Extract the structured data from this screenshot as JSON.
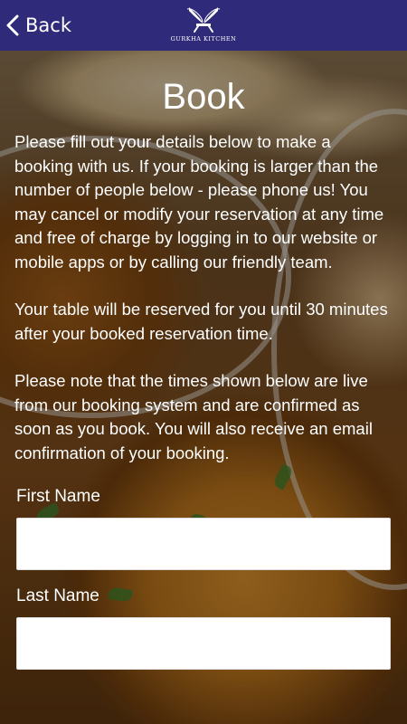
{
  "header": {
    "back_label": "Back",
    "brand": "GURKHA KITCHEN"
  },
  "page": {
    "title": "Book",
    "paragraphs": [
      "Please fill out your details below to make a booking with us. If your booking is larger than the number of people below - please phone us! You may cancel or modify your reservation at any time and free of charge by logging in to our website or mobile apps or by calling our friendly team.",
      "Your table will be reserved for you until 30 minutes after your booked reservation time.",
      "Please note that the times shown below are live from our booking system and are confirmed as soon as you book. You will also receive an email confirmation of your booking."
    ]
  },
  "form": {
    "first_name_label": "First Name",
    "first_name_value": "",
    "last_name_label": "Last Name",
    "last_name_value": ""
  },
  "colors": {
    "header_bg": "#2f2b7a",
    "text": "#ffffff"
  }
}
